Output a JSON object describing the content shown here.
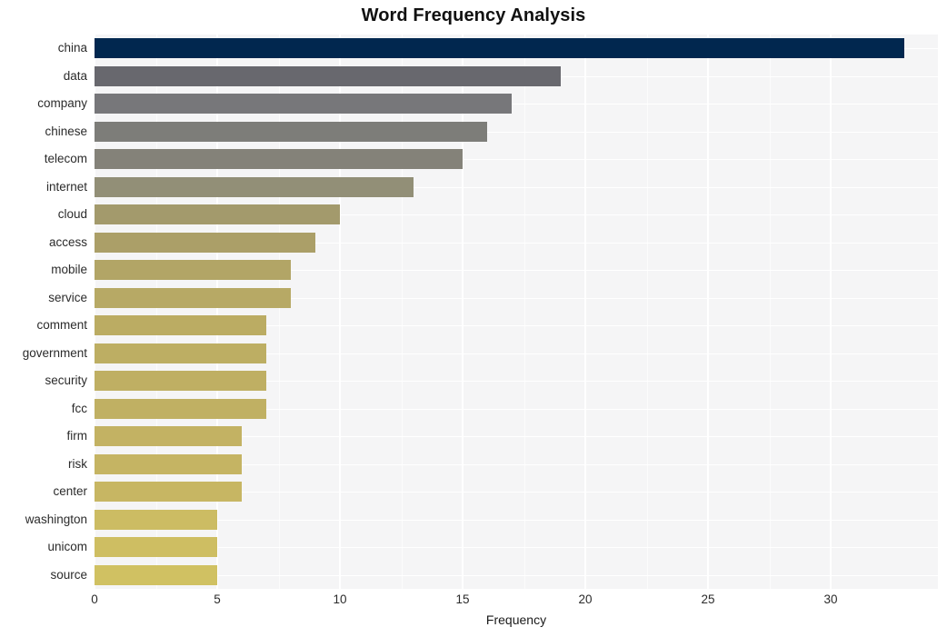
{
  "chart_data": {
    "type": "bar",
    "orientation": "horizontal",
    "title": "Word Frequency Analysis",
    "xlabel": "Frequency",
    "ylabel": "",
    "categories": [
      "china",
      "data",
      "company",
      "chinese",
      "telecom",
      "internet",
      "cloud",
      "access",
      "mobile",
      "service",
      "comment",
      "government",
      "security",
      "fcc",
      "firm",
      "risk",
      "center",
      "washington",
      "unicom",
      "source"
    ],
    "values": [
      33,
      19,
      17,
      16,
      15,
      13,
      10,
      9,
      8,
      8,
      7,
      7,
      7,
      7,
      6,
      6,
      6,
      5,
      5,
      5
    ],
    "bar_colors": [
      "#01274f",
      "#68686e",
      "#77777a",
      "#7d7d79",
      "#848279",
      "#928f77",
      "#a39a6c",
      "#ab9f68",
      "#b2a566",
      "#b7a965",
      "#bbac63",
      "#bdae63",
      "#bfaf63",
      "#c0b063",
      "#c3b263",
      "#c5b463",
      "#c7b663",
      "#ccbc63",
      "#cebe62",
      "#d0c162"
    ],
    "xlim": [
      0,
      34.37
    ],
    "xticks": [
      0,
      5,
      10,
      15,
      20,
      25,
      30
    ],
    "xtick_labels": [
      "0",
      "5",
      "10",
      "15",
      "20",
      "25",
      "30"
    ],
    "grid": true,
    "grid_color": "#ffffff",
    "panel_background": "#f5f5f6",
    "figure_background": "#ffffff",
    "legend": null
  }
}
